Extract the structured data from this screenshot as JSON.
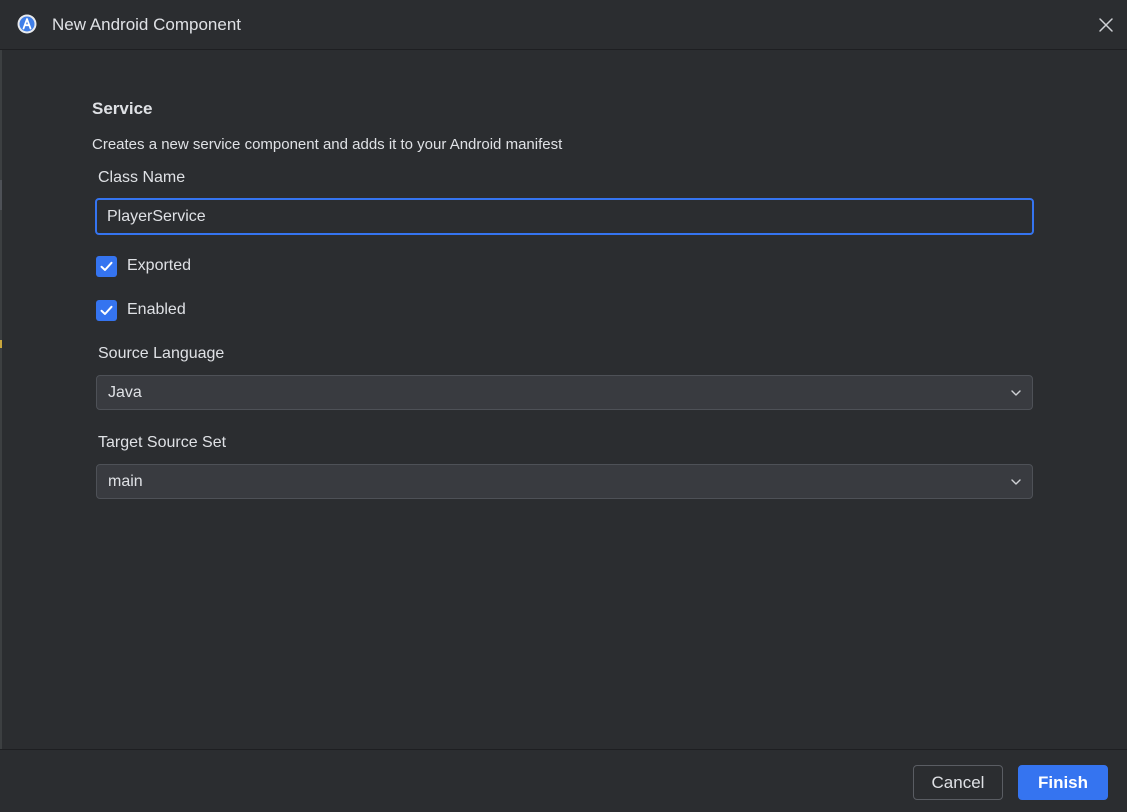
{
  "window": {
    "title": "New Android Component",
    "icon": "android-studio-icon",
    "close_icon": "close-icon"
  },
  "form": {
    "heading": "Service",
    "description": "Creates a new service component and adds it to your Android manifest",
    "class_name": {
      "label": "Class Name",
      "value": "PlayerService"
    },
    "exported": {
      "label": "Exported",
      "checked": true
    },
    "enabled": {
      "label": "Enabled",
      "checked": true
    },
    "source_language": {
      "label": "Source Language",
      "value": "Java"
    },
    "target_source_set": {
      "label": "Target Source Set",
      "value": "main"
    }
  },
  "footer": {
    "cancel_label": "Cancel",
    "finish_label": "Finish"
  },
  "colors": {
    "background": "#2b2d30",
    "accent": "#3574f0",
    "text": "#dfe1e5",
    "field_background": "#393b40"
  }
}
